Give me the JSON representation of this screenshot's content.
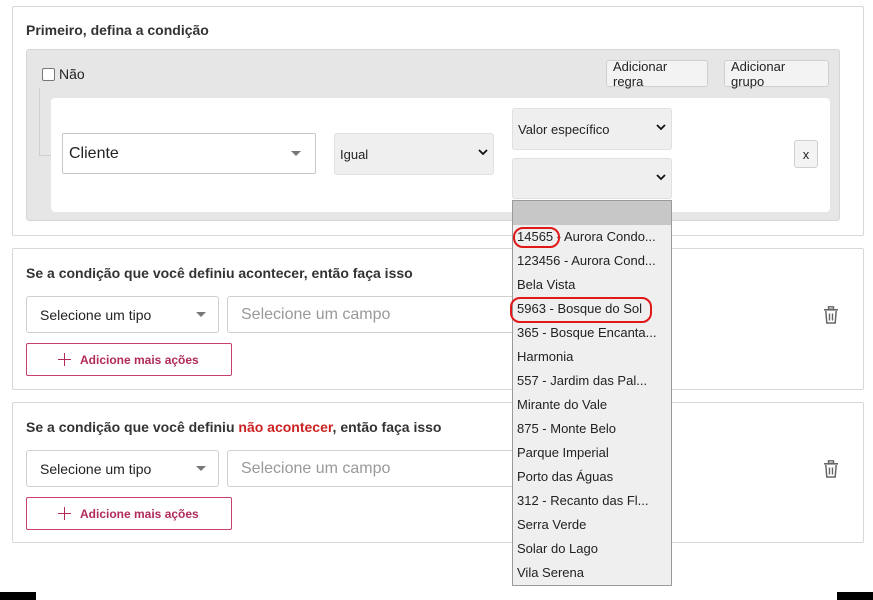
{
  "condition_panel": {
    "title": "Primeiro, defina a condição",
    "not_label": "Não",
    "add_rule": "Adicionar regra",
    "add_group": "Adicionar grupo",
    "field_value": "Cliente",
    "operator_value": "Igual",
    "value_type": "Valor específico",
    "value_selected": "",
    "remove_label": "x"
  },
  "then_panel": {
    "title": "Se a condição que você definiu acontecer, então faça isso",
    "type_placeholder": "Selecione um tipo",
    "field_placeholder": "Selecione um campo",
    "add_actions": "Adicione mais ações"
  },
  "else_panel": {
    "title_prefix": "Se a condição que você definiu ",
    "title_highlight": "não acontecer",
    "title_suffix": ", então faça isso",
    "type_placeholder": "Selecione um tipo",
    "field_placeholder": "Selecione um campo",
    "add_actions": "Adicione mais ações"
  },
  "dropdown_options": [
    "14565 - Aurora Condo...",
    "123456 - Aurora Cond...",
    "Bela Vista",
    "5963 - Bosque do Sol",
    "365 - Bosque Encanta...",
    "Harmonia",
    "557 - Jardim das Pal...",
    "Mirante do Vale",
    "875 - Monte Belo",
    "Parque Imperial",
    "Porto das Águas",
    "312 - Recanto das Fl...",
    "Serra Verde",
    "Solar do Lago",
    "Vila Serena"
  ],
  "colors": {
    "accent": "#b02a5c",
    "highlight_text": "#cc2222",
    "annotation_circle": "#e01818"
  }
}
